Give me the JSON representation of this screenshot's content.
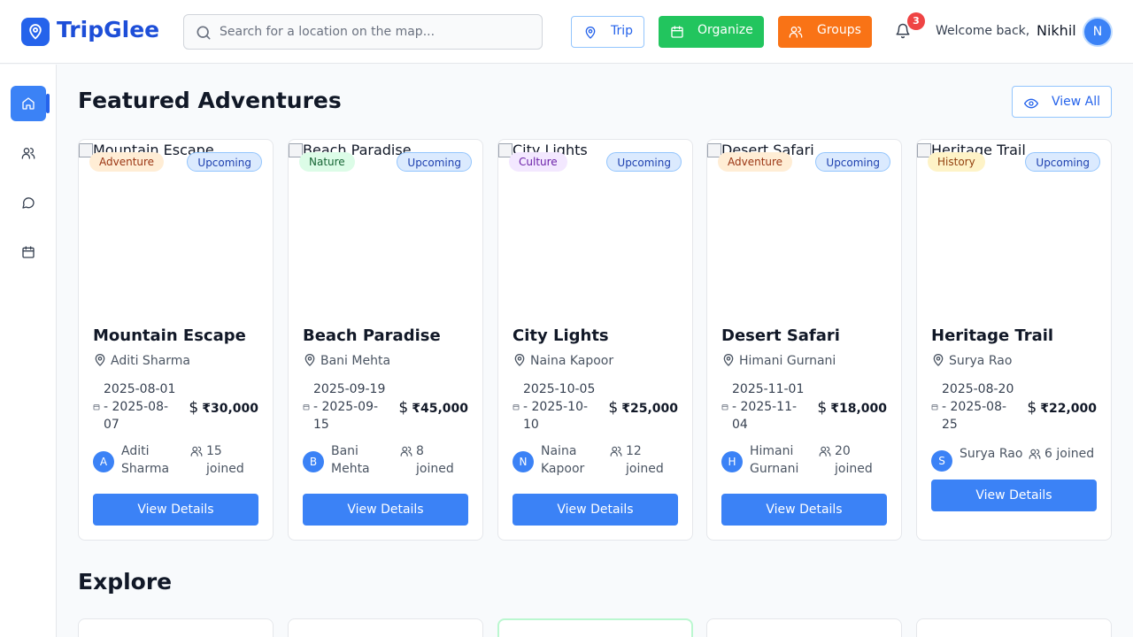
{
  "header": {
    "brand": "TripGlee",
    "search_placeholder": "Search for a location on the map...",
    "trip_label": "Trip",
    "organize_label": "Organize",
    "groups_label": "Groups",
    "notification_count": "3",
    "welcome": "Welcome back,",
    "user_name": "Nikhil",
    "user_initial": "N"
  },
  "sidebar": {
    "items": [
      {
        "icon": "home-icon",
        "active": true
      },
      {
        "icon": "users-icon",
        "active": false
      },
      {
        "icon": "chat-icon",
        "active": false
      },
      {
        "icon": "calendar-icon",
        "active": false
      }
    ]
  },
  "featured": {
    "title": "Featured Adventures",
    "view_all": "View All"
  },
  "cards": [
    {
      "image_alt": "Mountain Escape",
      "category": "Adventure",
      "status": "Upcoming",
      "title": "Mountain Escape",
      "location": "Aditi Sharma",
      "date_line1": "2025-08-01",
      "date_line2": "- 2025-08-",
      "date_line3": "07",
      "price": "₹30,000",
      "host_initial": "A",
      "host_line1": "Aditi",
      "host_line2": "Sharma",
      "joined_line1": "15",
      "joined_line2": "joined",
      "button": "View Details"
    },
    {
      "image_alt": "Beach Paradise",
      "category": "Nature",
      "status": "Upcoming",
      "title": "Beach Paradise",
      "location": "Bani Mehta",
      "date_line1": "2025-09-19",
      "date_line2": "- 2025-09-",
      "date_line3": "15",
      "price": "₹45,000",
      "host_initial": "B",
      "host_line1": "Bani",
      "host_line2": "Mehta",
      "joined_line1": "8",
      "joined_line2": "joined",
      "button": "View Details"
    },
    {
      "image_alt": "City Lights",
      "category": "Culture",
      "status": "Upcoming",
      "title": "City Lights",
      "location": "Naina Kapoor",
      "date_line1": "2025-10-05",
      "date_line2": "- 2025-10-",
      "date_line3": "10",
      "price": "₹25,000",
      "host_initial": "N",
      "host_line1": "Naina",
      "host_line2": "Kapoor",
      "joined_line1": "12",
      "joined_line2": "joined",
      "button": "View Details"
    },
    {
      "image_alt": "Desert Safari",
      "category": "Adventure",
      "status": "Upcoming",
      "title": "Desert Safari",
      "location": "Himani Gurnani",
      "date_line1": "2025-11-01",
      "date_line2": "- 2025-11-",
      "date_line3": "04",
      "price": "₹18,000",
      "host_initial": "H",
      "host_line1": "Himani",
      "host_line2": "Gurnani",
      "joined_line1": "20",
      "joined_line2": "joined",
      "button": "View Details"
    },
    {
      "image_alt": "Heritage Trail",
      "category": "History",
      "status": "Upcoming",
      "title": "Heritage Trail",
      "location": "Surya Rao",
      "date_line1": "2025-08-20",
      "date_line2": "- 2025-08-",
      "date_line3": "25",
      "price": "₹22,000",
      "host_initial": "S",
      "host_line1": "Surya Rao",
      "host_line2": "",
      "joined_line1": "6 joined",
      "joined_line2": "",
      "button": "View Details"
    }
  ],
  "category_colors": {
    "Adventure": {
      "bg": "#ffedd5",
      "fg": "#9a3412"
    },
    "Nature": {
      "bg": "#dcfce7",
      "fg": "#166534"
    },
    "Culture": {
      "bg": "#f3e8ff",
      "fg": "#6b21a8"
    },
    "History": {
      "bg": "#fef3c7",
      "fg": "#92400e"
    }
  },
  "explore": {
    "title": "Explore"
  },
  "colors": {
    "primary": "#3b82f6",
    "organize": "#22c55e",
    "groups": "#f97316",
    "badge": "#ef4444"
  }
}
